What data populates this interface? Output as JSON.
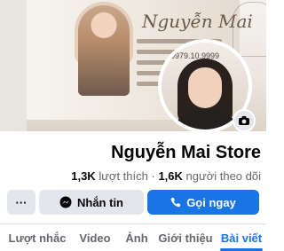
{
  "cover": {
    "brand_text": "Nguyễn Mai"
  },
  "avatar": {
    "sign_text": "0979.10.9999"
  },
  "profile": {
    "name": "Nguyễn Mai Store",
    "likes_count": "1,3K",
    "likes_label": "lượt thích",
    "separator": "·",
    "followers_count": "1,6K",
    "followers_label": "người theo dõi"
  },
  "actions": {
    "call_label": "Gọi ngay",
    "message_label": "Nhắn tin",
    "more_label": "···"
  },
  "tabs": [
    {
      "label": "Bài viết",
      "active": true
    },
    {
      "label": "Giới thiệu",
      "active": false
    },
    {
      "label": "Ảnh",
      "active": false
    },
    {
      "label": "Video",
      "active": false
    },
    {
      "label": "Lượt nhắc",
      "active": false
    }
  ],
  "colors": {
    "accent": "#1b74e4",
    "button_secondary": "#e4e6eb",
    "muted_text": "#65676b"
  }
}
